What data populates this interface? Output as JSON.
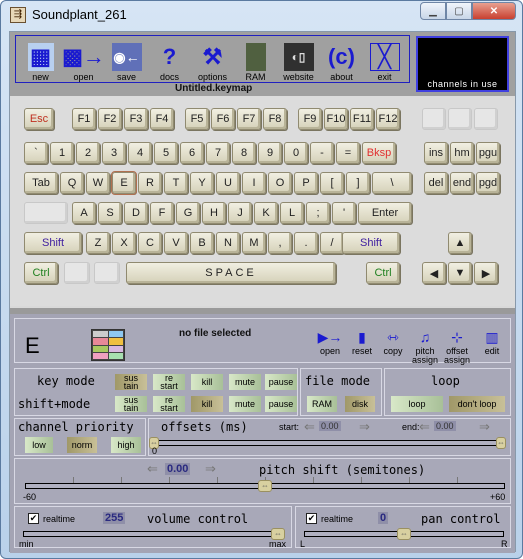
{
  "window": {
    "title": "Soundplant_261",
    "icon": "soundplant-app-icon",
    "controls": [
      "minimize",
      "maximize",
      "close"
    ]
  },
  "toolbar": {
    "items": [
      {
        "label": "new",
        "icon": "new-file-icon"
      },
      {
        "label": "open",
        "icon": "open-folder-icon"
      },
      {
        "label": "save",
        "icon": "save-disk-icon"
      },
      {
        "label": "docs",
        "icon": "question-mark-icon"
      },
      {
        "label": "options",
        "icon": "tools-icon"
      },
      {
        "label": "RAM",
        "icon": "ram-chip-icon"
      },
      {
        "label": "website",
        "icon": "website-icon"
      },
      {
        "label": "about",
        "icon": "copyright-icon"
      },
      {
        "label": "exit",
        "icon": "exit-x-icon"
      }
    ],
    "keymap_name": "Untitled.keymap"
  },
  "channels": {
    "label": "channels in use"
  },
  "keyboard": {
    "fn_row": [
      "Esc",
      "F1",
      "F2",
      "F3",
      "F4",
      "F5",
      "F6",
      "F7",
      "F8",
      "F9",
      "F10",
      "F11",
      "F12"
    ],
    "num_row": [
      "`",
      "1",
      "2",
      "3",
      "4",
      "5",
      "6",
      "7",
      "8",
      "9",
      "0",
      "-",
      "=",
      "Bksp"
    ],
    "q_row": [
      "Tab",
      "Q",
      "W",
      "E",
      "R",
      "T",
      "Y",
      "U",
      "I",
      "O",
      "P",
      "[",
      "]",
      "\\"
    ],
    "a_row": [
      "",
      "A",
      "S",
      "D",
      "F",
      "G",
      "H",
      "J",
      "K",
      "L",
      ";",
      "'",
      "Enter"
    ],
    "z_row": [
      "Shift",
      "Z",
      "X",
      "C",
      "V",
      "B",
      "N",
      "M",
      ",",
      ".",
      "/",
      "Shift"
    ],
    "bottom_row": {
      "left_ctrl": "Ctrl",
      "space": "SPACE",
      "right_ctrl": "Ctrl"
    },
    "nav": [
      "ins",
      "hm",
      "pgu",
      "del",
      "end",
      "pgd"
    ],
    "arrows": {
      "up": "▲",
      "left": "◀",
      "down": "▼",
      "right": "▶"
    },
    "selected_key": "E"
  },
  "key_panel": {
    "key": "E",
    "file_status": "no file selected",
    "actions": [
      {
        "label": "open",
        "icon": "open-folder-icon"
      },
      {
        "label": "reset",
        "icon": "reset-icon"
      },
      {
        "label": "copy",
        "icon": "copy-icon"
      },
      {
        "label": "pitch\nassign",
        "icon": "pitch-assign-icon"
      },
      {
        "label": "offset\nassign",
        "icon": "offset-assign-icon"
      },
      {
        "label": "edit",
        "icon": "waveform-edit-icon"
      }
    ]
  },
  "modes": {
    "key_mode_label": "key mode",
    "shift_mode_label": "shift+mode",
    "options": [
      "sus tain",
      "re start",
      "kill",
      "mute",
      "pause"
    ],
    "key_mode_selected": "sustain",
    "shift_mode_selected": "kill",
    "file_mode_label": "file mode",
    "file_mode_options": [
      "RAM",
      "disk"
    ],
    "file_mode_selected": "disk",
    "loop_label": "loop",
    "loop_options": [
      "loop",
      "don't loop"
    ],
    "loop_selected": "don't loop"
  },
  "priority": {
    "label": "channel priority",
    "options": [
      "low",
      "norm",
      "high"
    ],
    "selected": "norm"
  },
  "offsets": {
    "label": "offsets (ms)",
    "start_label": "start:",
    "start_value": "0.00",
    "end_label": "end:",
    "end_value": "0.00",
    "min_label": "0"
  },
  "pitch": {
    "label": "pitch shift (semitones)",
    "value": "0.00",
    "min_label": "-60",
    "max_label": "+60",
    "min": -60,
    "max": 60,
    "current": 0
  },
  "volume": {
    "realtime_label": "realtime",
    "realtime_checked": true,
    "value": "255",
    "label": "volume control",
    "min_label": "min",
    "max_label": "max",
    "fraction": 1.0
  },
  "pan": {
    "realtime_label": "realtime",
    "realtime_checked": true,
    "value": "0",
    "label": "pan control",
    "left_label": "L",
    "right_label": "R",
    "fraction": 0.5
  }
}
